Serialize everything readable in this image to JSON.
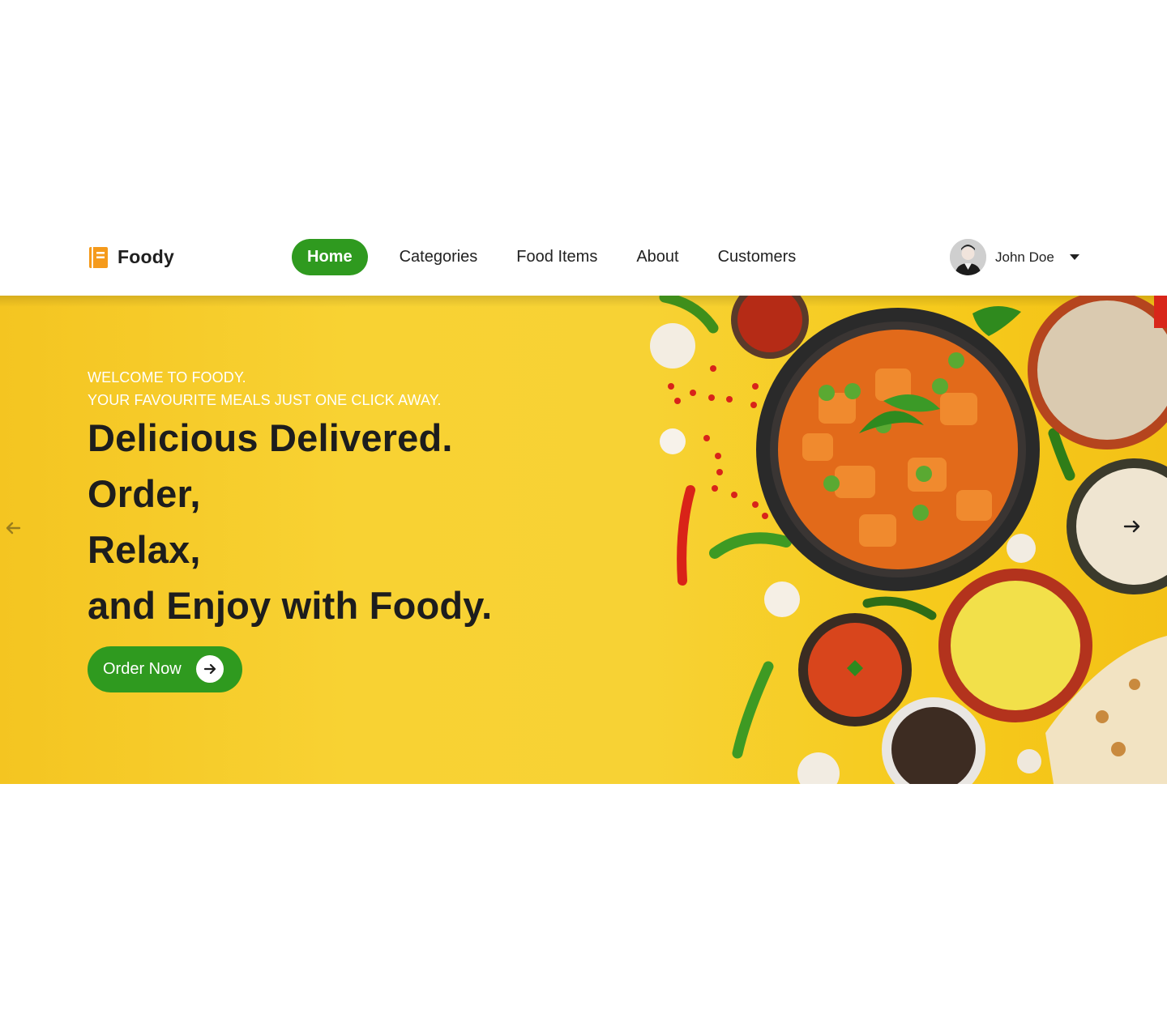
{
  "brand": {
    "name": "Foody",
    "icon": "notebook-icon",
    "icon_color": "#f59a1b"
  },
  "nav": {
    "items": [
      {
        "label": "Home",
        "active": true
      },
      {
        "label": "Categories",
        "active": false
      },
      {
        "label": "Food Items",
        "active": false
      },
      {
        "label": "About",
        "active": false
      },
      {
        "label": "Customers",
        "active": false
      }
    ]
  },
  "user": {
    "name": "John Doe",
    "icon": "chevron-down-icon"
  },
  "hero": {
    "welcome_line1": "WELCOME TO FOODY.",
    "welcome_line2": "YOUR FAVOURITE MEALS JUST ONE CLICK AWAY.",
    "headline": [
      "Delicious Delivered.",
      "Order,",
      "Relax,",
      "and Enjoy with Foody."
    ],
    "cta_label": "Order Now",
    "cta_icon": "arrow-right-icon",
    "prev_icon": "arrow-left-icon",
    "next_icon": "arrow-right-icon"
  },
  "colors": {
    "accent": "#2f9a1f",
    "hero_bg": "#f7d234",
    "headline": "#1d1d1d"
  }
}
